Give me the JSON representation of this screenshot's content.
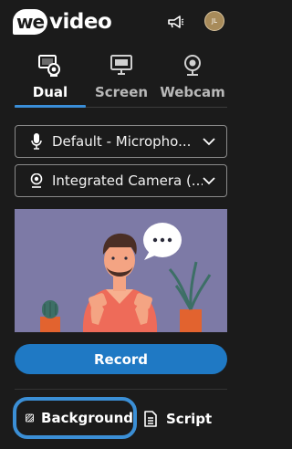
{
  "app": {
    "brand": "wevideo",
    "avatar_initials": "JL"
  },
  "tabs": [
    {
      "label": "Dual",
      "icon": "dual-screen-webcam-icon",
      "active": true
    },
    {
      "label": "Screen",
      "icon": "monitor-icon",
      "active": false
    },
    {
      "label": "Webcam",
      "icon": "webcam-icon",
      "active": false
    }
  ],
  "selects": {
    "microphone": {
      "value": "Default - Micropho...",
      "icon": "microphone-icon"
    },
    "camera": {
      "value": "Integrated Camera (...",
      "icon": "webcam-icon"
    }
  },
  "preview": {
    "speech_bubble": "..."
  },
  "record_label": "Record",
  "bottom": {
    "background_label": "Background",
    "script_label": "Script"
  },
  "colors": {
    "accent": "#1f79c4",
    "highlight": "#3b8fd6",
    "preview_bg": "#7d7aa6"
  }
}
